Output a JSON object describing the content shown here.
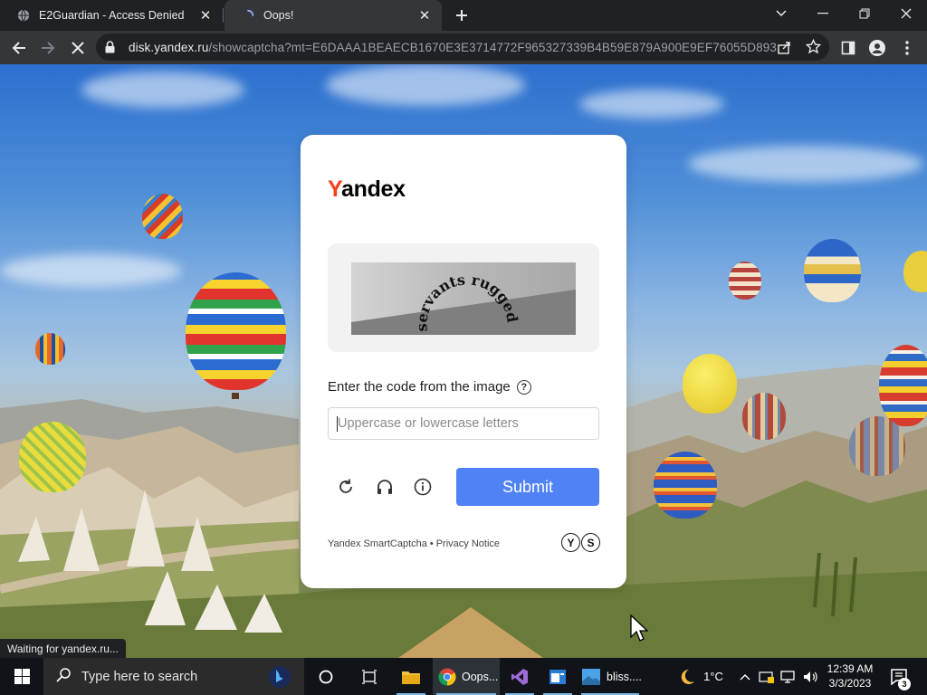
{
  "browser": {
    "tabs": [
      {
        "title": "E2Guardian - Access Denied",
        "favicon": "globe-icon"
      },
      {
        "title": "Oops!",
        "favicon": "loading-spinner-icon",
        "active": true
      }
    ],
    "url": {
      "host": "disk.yandex.ru",
      "rest": "/showcaptcha?mt=E6DAAA1BEAECB1670E3E3714772F965327339B4B59E879A900E9EF76055D893..."
    },
    "status_text": "Waiting for yandex.ru..."
  },
  "captcha": {
    "logo_first": "Y",
    "logo_rest": "andex",
    "captcha_text": "servants rugged",
    "prompt": "Enter the code from the image",
    "help_glyph": "?",
    "input_placeholder": "Uppercase or lowercase letters",
    "submit_label": "Submit",
    "footer_left": "Yandex SmartCaptcha",
    "footer_sep": "•",
    "footer_right": "Privacy Notice",
    "badge_letters": [
      "Y",
      "S"
    ]
  },
  "taskbar": {
    "search_placeholder": "Type here to search",
    "chrome_label": "Oops...",
    "bliss_label": "bliss....",
    "weather": "1°C",
    "time": "12:39 AM",
    "date": "3/3/2023",
    "notification_count": "3"
  },
  "colors": {
    "accent_submit": "#4e82f5",
    "yandex_red": "#fc3f1d",
    "browser_dark": "#202124",
    "browser_toolbar": "#35363a"
  }
}
